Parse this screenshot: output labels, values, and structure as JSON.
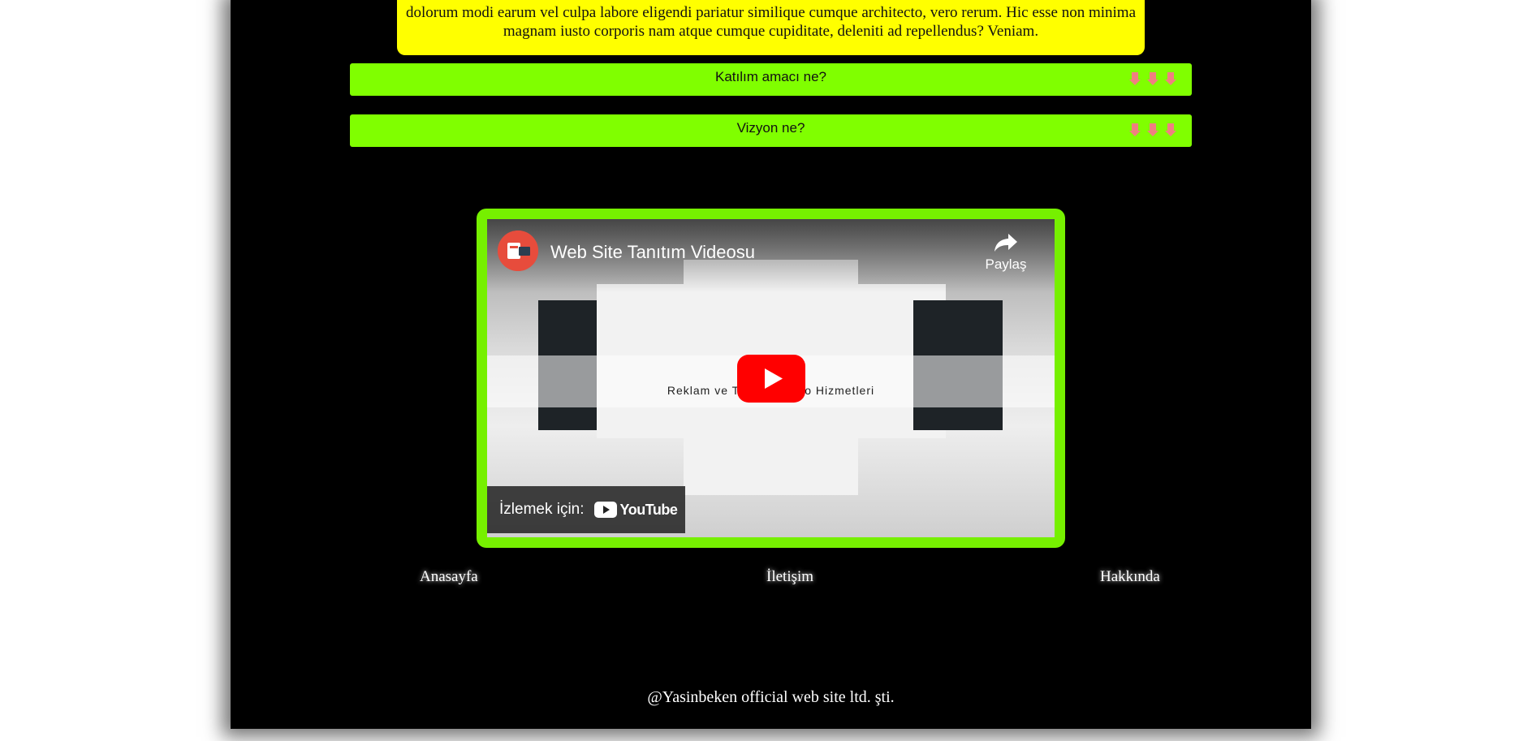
{
  "about_box": {
    "text": "dolorum modi earum vel culpa labore eligendi pariatur similique cumque architecto, vero rerum. Hic esse non minima magnam iusto corporis nam atque cumque cupiditate, deleniti ad repellendus? Veniam."
  },
  "accordion": [
    {
      "label": "Katılım amacı ne?"
    },
    {
      "label": "Vizyon ne?"
    }
  ],
  "video": {
    "title": "Web Site Tanıtım Videosu",
    "share_label": "Paylaş",
    "band_text": "Reklam ve Tanıtım Video Hizmetleri",
    "watch_on_label": "İzlemek için:",
    "youtube_label": "YouTube"
  },
  "nav": {
    "home": "Anasayfa",
    "contact": "İletişim",
    "about": "Hakkında"
  },
  "footer": {
    "text": "@Yasinbeken official web site ltd. şti."
  },
  "colors": {
    "page_bg": "#000000",
    "yellow": "#ffff00",
    "accordion_green": "#80ff00",
    "frame_green": "#76f000",
    "arrow_pink": "#f08080"
  }
}
